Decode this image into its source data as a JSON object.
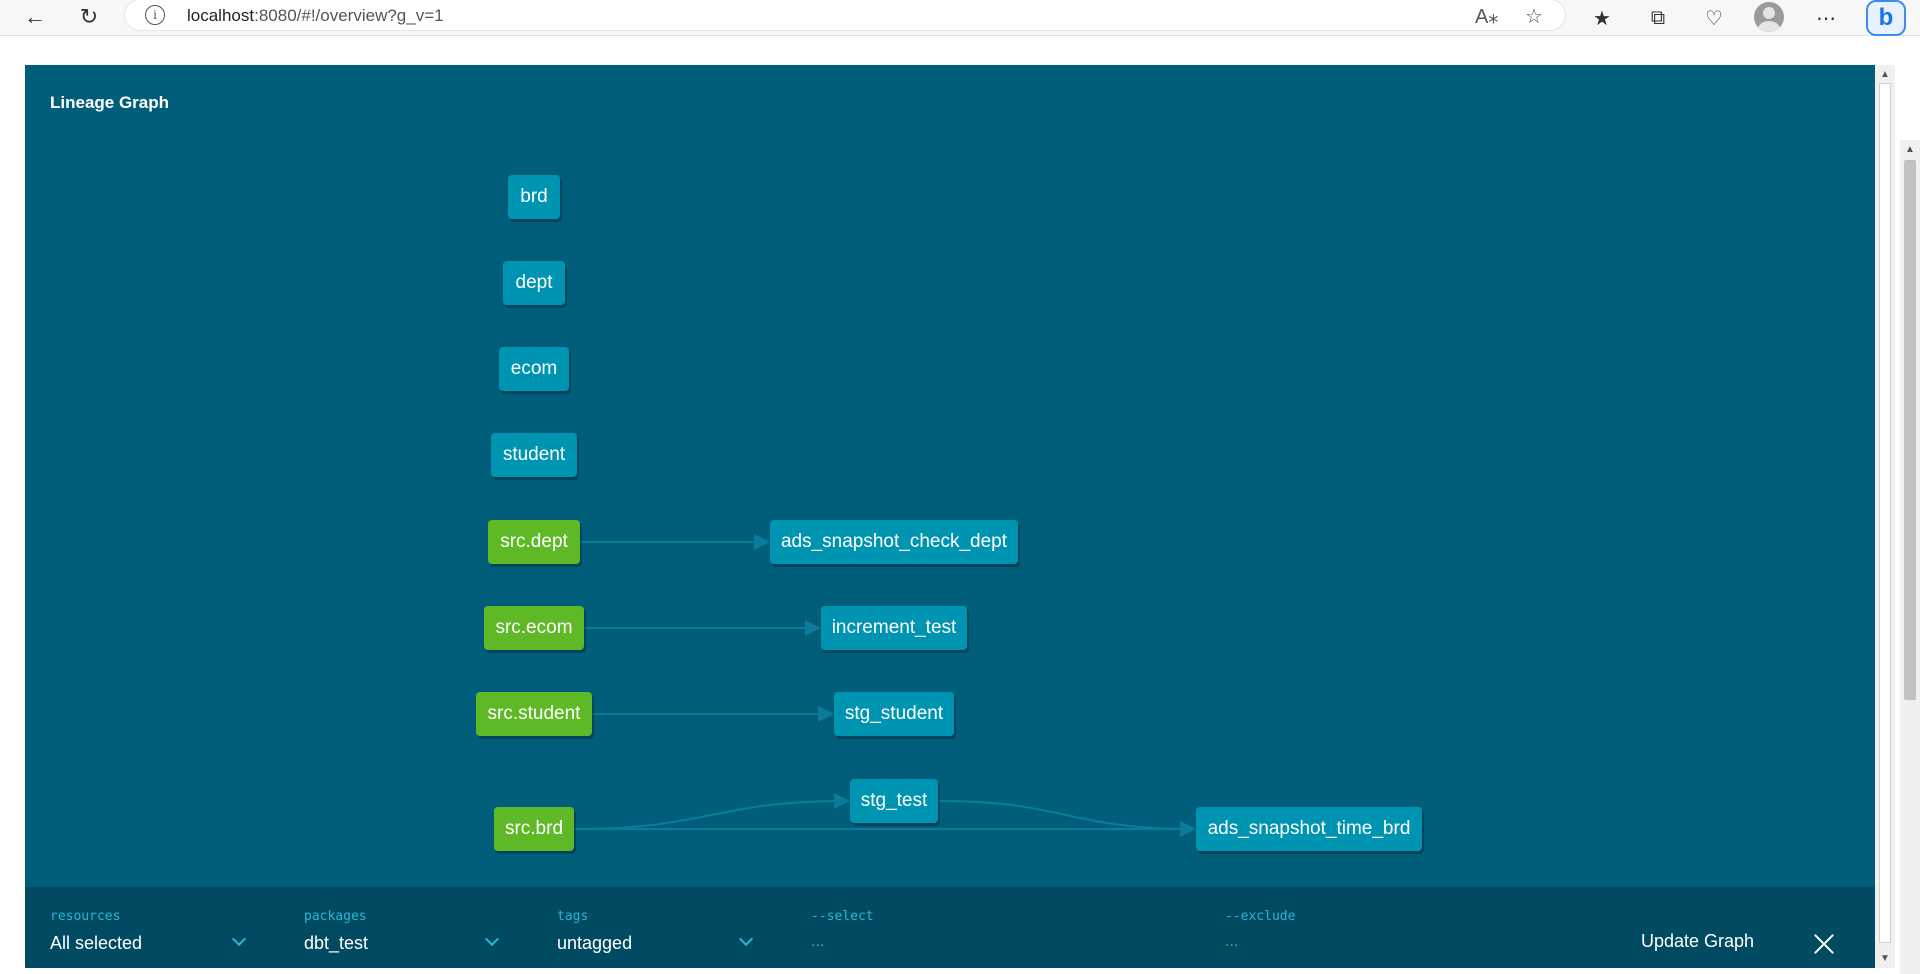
{
  "browser": {
    "url_host": "localhost",
    "url_rest": ":8080/#!/overview?g_v=1",
    "back_icon": "back-arrow-icon",
    "refresh_icon": "refresh-icon"
  },
  "modal": {
    "title": "Lineage Graph"
  },
  "graph": {
    "nodes": [
      {
        "id": "brd",
        "label": "brd",
        "kind": "model"
      },
      {
        "id": "dept",
        "label": "dept",
        "kind": "model"
      },
      {
        "id": "ecom",
        "label": "ecom",
        "kind": "model"
      },
      {
        "id": "student",
        "label": "student",
        "kind": "model"
      },
      {
        "id": "src_dept",
        "label": "src.dept",
        "kind": "source"
      },
      {
        "id": "ads_snapshot_check_dept",
        "label": "ads_snapshot_check_dept",
        "kind": "model"
      },
      {
        "id": "src_ecom",
        "label": "src.ecom",
        "kind": "source"
      },
      {
        "id": "increment_test",
        "label": "increment_test",
        "kind": "model"
      },
      {
        "id": "src_student",
        "label": "src.student",
        "kind": "source"
      },
      {
        "id": "stg_student",
        "label": "stg_student",
        "kind": "model"
      },
      {
        "id": "stg_test",
        "label": "stg_test",
        "kind": "model"
      },
      {
        "id": "src_brd",
        "label": "src.brd",
        "kind": "source"
      },
      {
        "id": "ads_snapshot_time_brd",
        "label": "ads_snapshot_time_brd",
        "kind": "model"
      }
    ],
    "edges": [
      [
        "src_dept",
        "ads_snapshot_check_dept"
      ],
      [
        "src_ecom",
        "increment_test"
      ],
      [
        "src_student",
        "stg_student"
      ],
      [
        "src_brd",
        "stg_test"
      ],
      [
        "src_brd",
        "ads_snapshot_time_brd"
      ],
      [
        "stg_test",
        "ads_snapshot_time_brd"
      ]
    ],
    "colors": {
      "model": "#0094b3",
      "source": "#5fb825",
      "edge": "#0a7c9a",
      "background": "#005e7b"
    }
  },
  "filters": {
    "resources": {
      "label": "resources",
      "value": "All selected"
    },
    "packages": {
      "label": "packages",
      "value": "dbt_test"
    },
    "tags": {
      "label": "tags",
      "value": "untagged"
    },
    "select": {
      "label": "--select",
      "value": "..."
    },
    "exclude": {
      "label": "--exclude",
      "value": "..."
    }
  },
  "actions": {
    "update_label": "Update Graph"
  }
}
